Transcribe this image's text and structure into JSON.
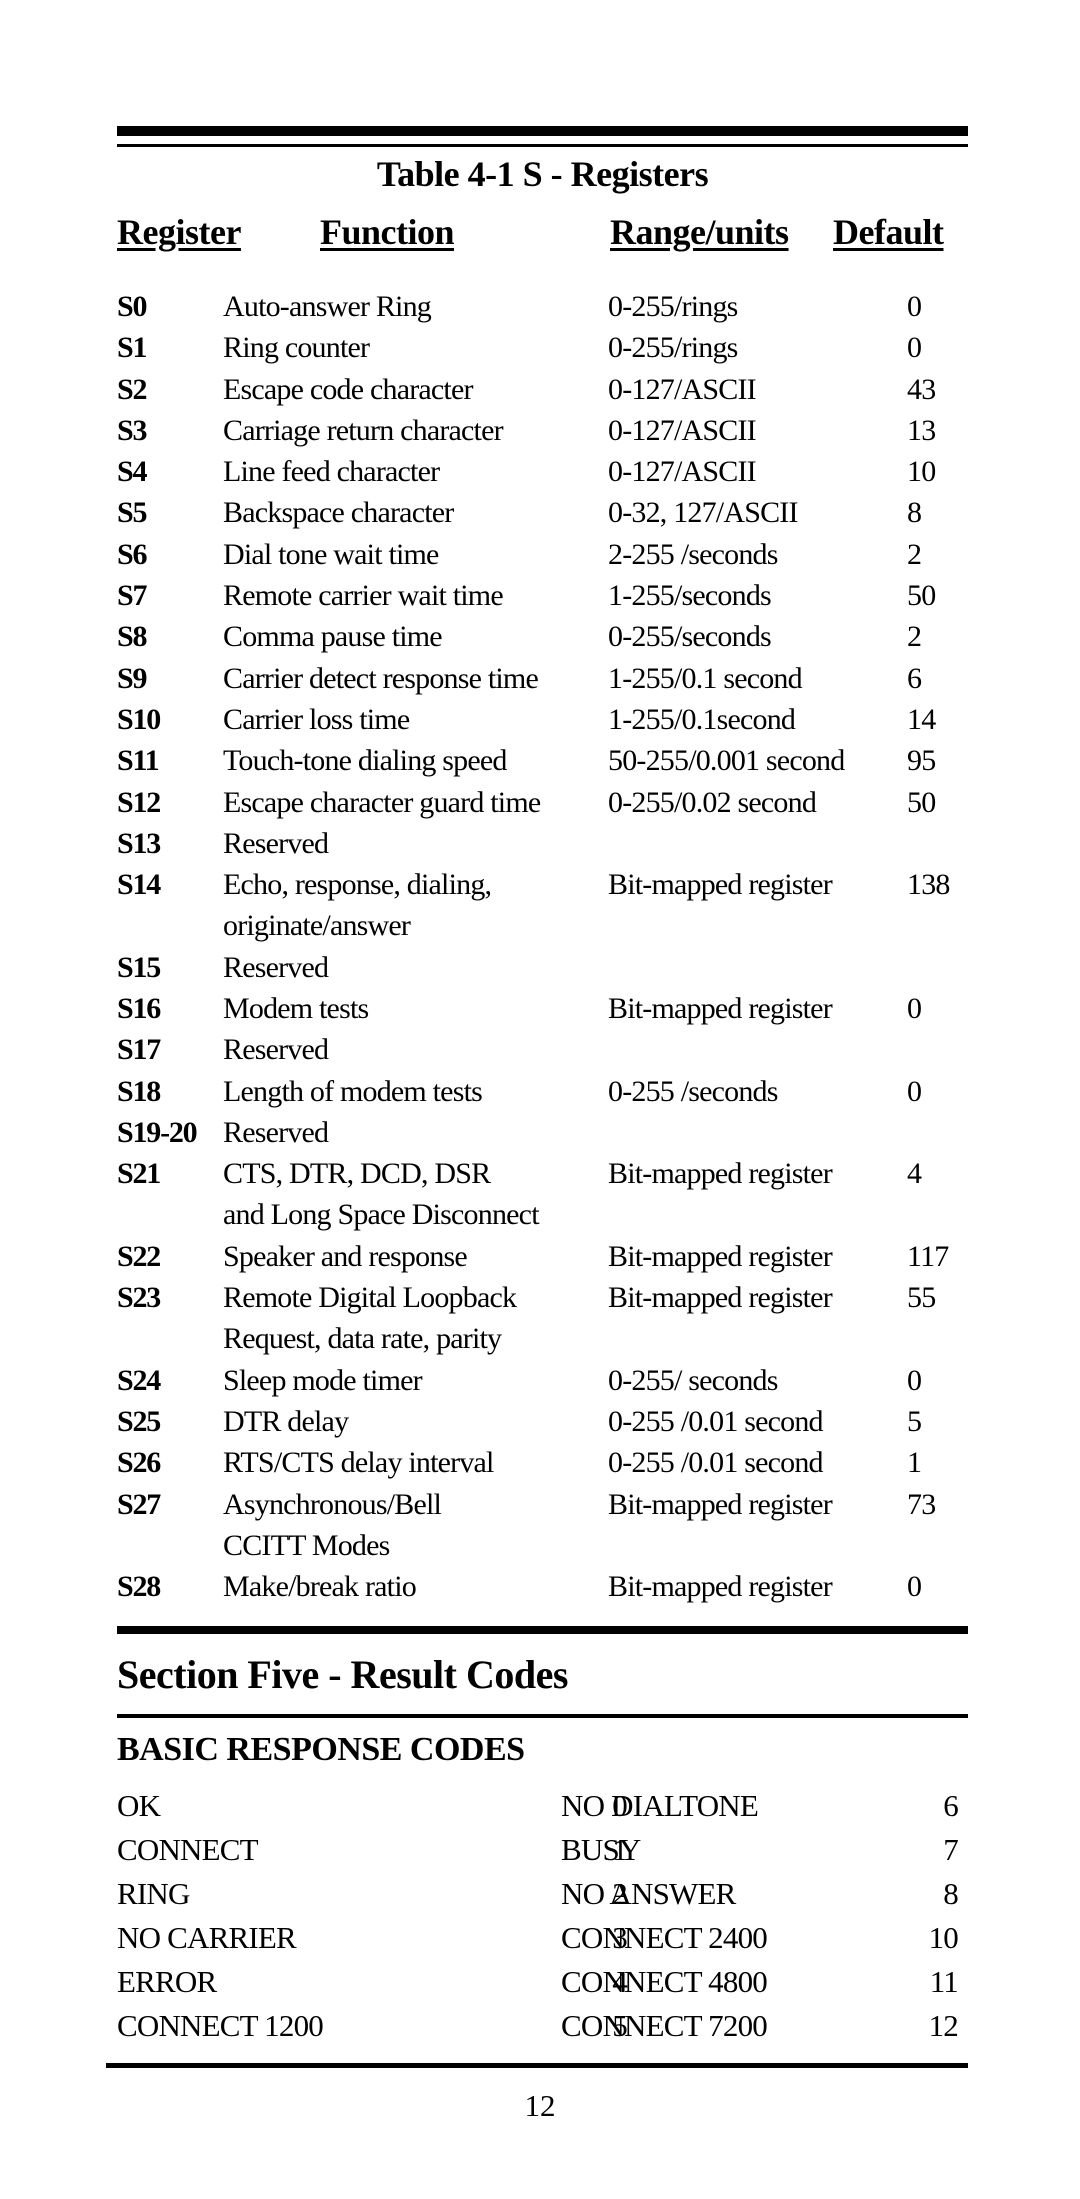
{
  "table": {
    "title": "Table 4-1 S - Registers",
    "headers": {
      "register": "Register",
      "function": "Function",
      "range": "Range/units",
      "default": "Default"
    },
    "rows": [
      {
        "reg": "S0",
        "fn": "Auto-answer Ring",
        "range": "0-255/rings",
        "def": "0"
      },
      {
        "reg": "S1",
        "fn": "Ring counter",
        "range": "0-255/rings",
        "def": "0"
      },
      {
        "reg": "S2",
        "fn": "Escape code character",
        "range": "0-127/ASCII",
        "def": "43"
      },
      {
        "reg": "S3",
        "fn": "Carriage return character",
        "range": "0-127/ASCII",
        "def": "13"
      },
      {
        "reg": "S4",
        "fn": "Line feed character",
        "range": "0-127/ASCII",
        "def": "10"
      },
      {
        "reg": "S5",
        "fn": "Backspace character",
        "range": "0-32, 127/ASCII",
        "def": "8"
      },
      {
        "reg": "S6",
        "fn": "Dial tone wait time",
        "range": "2-255 /seconds",
        "def": "2"
      },
      {
        "reg": "S7",
        "fn": "Remote carrier wait time",
        "range": "1-255/seconds",
        "def": "50"
      },
      {
        "reg": "S8",
        "fn": "Comma pause time",
        "range": "0-255/seconds",
        "def": "2"
      },
      {
        "reg": "S9",
        "fn": "Carrier detect response time",
        "range": "1-255/0.1 second",
        "def": "6"
      },
      {
        "reg": "S10",
        "fn": "Carrier loss time",
        "range": "1-255/0.1second",
        "def": "14"
      },
      {
        "reg": "S11",
        "fn": "Touch-tone dialing speed",
        "range": "50-255/0.001 second",
        "def": "95"
      },
      {
        "reg": "S12",
        "fn": "Escape character guard time",
        "range": "0-255/0.02 second",
        "def": "50"
      },
      {
        "reg": "S13",
        "fn": "Reserved",
        "range": "",
        "def": ""
      },
      {
        "reg": "S14",
        "fn": "Echo, response, dialing,",
        "fn2": "originate/answer",
        "range": "Bit-mapped register",
        "def": "138"
      },
      {
        "reg": "S15",
        "fn": "Reserved",
        "range": "",
        "def": ""
      },
      {
        "reg": "S16",
        "fn": "Modem tests",
        "range": "Bit-mapped register",
        "def": "0"
      },
      {
        "reg": "S17",
        "fn": "Reserved",
        "range": "",
        "def": ""
      },
      {
        "reg": "S18",
        "fn": "Length of modem tests",
        "range": "0-255 /seconds",
        "def": "0"
      },
      {
        "reg": "S19-20",
        "fn": "Reserved",
        "range": "",
        "def": ""
      },
      {
        "reg": "S21",
        "fn": "CTS, DTR, DCD, DSR",
        "fn2": "and Long Space Disconnect",
        "range": "Bit-mapped register",
        "def": "4"
      },
      {
        "reg": "S22",
        "fn": "Speaker and response",
        "range": "Bit-mapped register",
        "def": "117"
      },
      {
        "reg": "S23",
        "fn": "Remote Digital Loopback",
        "fn2": "Request, data rate, parity",
        "range": "Bit-mapped register",
        "def": "55"
      },
      {
        "reg": "S24",
        "fn": "Sleep mode timer",
        "range": "0-255/ seconds",
        "def": "0"
      },
      {
        "reg": "S25",
        "fn": "DTR delay",
        "range": "0-255 /0.01 second",
        "def": "5"
      },
      {
        "reg": "S26",
        "fn": "RTS/CTS delay interval",
        "range": "0-255 /0.01 second",
        "def": "1"
      },
      {
        "reg": "S27",
        "fn": "Asynchronous/Bell",
        "fn2": "CCITT Modes",
        "range": "Bit-mapped register",
        "def": "73"
      },
      {
        "reg": "S28",
        "fn": "Make/break ratio",
        "range": "Bit-mapped register",
        "def": "0"
      }
    ]
  },
  "section": {
    "title": "Section Five - Result Codes",
    "subtitle": "BASIC RESPONSE CODES",
    "codes": [
      {
        "left_name": "OK",
        "left_code": "0",
        "right_name": "NO DIALTONE",
        "right_code": "6"
      },
      {
        "left_name": "CONNECT",
        "left_code": "1",
        "right_name": "BUSY",
        "right_code": "7"
      },
      {
        "left_name": "RING",
        "left_code": "2",
        "right_name": "NO ANSWER",
        "right_code": "8"
      },
      {
        "left_name": "NO CARRIER",
        "left_code": "3",
        "right_name": "CONNECT 2400",
        "right_code": "10"
      },
      {
        "left_name": "ERROR",
        "left_code": "4",
        "right_name": "CONNECT 4800",
        "right_code": "11"
      },
      {
        "left_name": "CONNECT 1200",
        "left_code": "5",
        "right_name": "CONNECT 7200",
        "right_code": "12"
      }
    ]
  },
  "page_number": "12"
}
